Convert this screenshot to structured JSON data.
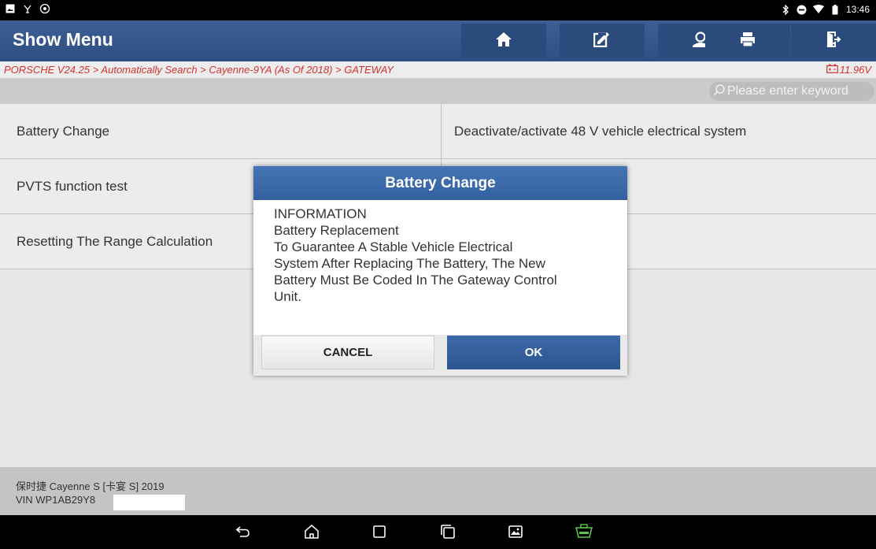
{
  "status_bar": {
    "time": "13:46",
    "left_icons": [
      "gallery-icon",
      "usb-icon",
      "settings-icon"
    ],
    "right_icons": [
      "bluetooth-icon",
      "do-not-disturb-icon",
      "wifi-icon",
      "battery-icon"
    ]
  },
  "header": {
    "title": "Show Menu",
    "buttons": [
      "home-icon",
      "edit-report-icon",
      "profile-icon",
      "print-icon",
      "exit-icon"
    ]
  },
  "breadcrumb": {
    "path": "PORSCHE V24.25 > Automatically Search > Cayenne-9YA (As Of 2018) > GATEWAY",
    "voltage": "11.96V"
  },
  "search": {
    "placeholder": "Please enter keyword"
  },
  "functions": {
    "rows": [
      {
        "left": "Battery Change",
        "right": "Deactivate/activate 48 V vehicle electrical system"
      },
      {
        "left": "PVTS function test",
        "right": ""
      },
      {
        "left": "Resetting The Range Calculation",
        "right": ""
      }
    ]
  },
  "vehicle_info": {
    "model": "保时捷 Cayenne S [卡宴 S] 2019",
    "vin": "VIN WP1AB29Y8"
  },
  "dialog": {
    "title": "Battery Change",
    "lines": [
      "INFORMATION",
      "Battery Replacement",
      "To Guarantee A Stable Vehicle Electrical",
      "System After Replacing The Battery, The New",
      "Battery Must Be Coded In The Gateway Control",
      "Unit."
    ],
    "cancel_label": "CANCEL",
    "ok_label": "OK"
  },
  "colors": {
    "header": "#2e4f80",
    "breadcrumb_text": "#d4322c",
    "dialog_title": "#3c69a8",
    "ok_button": "#2d5690",
    "obd_icon": "#5fc14a"
  }
}
